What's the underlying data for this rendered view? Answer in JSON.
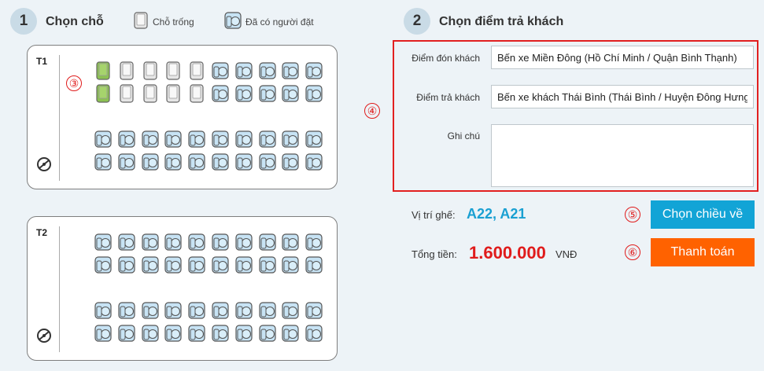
{
  "step1": {
    "number": "1",
    "title": "Chọn chỗ"
  },
  "legend": {
    "empty": "Chỗ trống",
    "booked": "Đã có người đặt"
  },
  "step2": {
    "number": "2",
    "title": "Chọn điểm trả khách"
  },
  "decks": [
    {
      "label": "T1",
      "rows": [
        [
          "selected",
          "empty",
          "empty",
          "empty",
          "empty",
          "booked",
          "booked",
          "booked",
          "booked",
          "booked"
        ],
        [
          "selected",
          "empty",
          "empty",
          "empty",
          "empty",
          "booked",
          "booked",
          "booked",
          "booked",
          "booked"
        ],
        [
          "booked",
          "booked",
          "booked",
          "booked",
          "booked",
          "booked",
          "booked",
          "booked",
          "booked",
          "booked"
        ],
        [
          "booked",
          "booked",
          "booked",
          "booked",
          "booked",
          "booked",
          "booked",
          "booked",
          "booked",
          "booked"
        ]
      ]
    },
    {
      "label": "T2",
      "rows": [
        [
          "booked",
          "booked",
          "booked",
          "booked",
          "booked",
          "booked",
          "booked",
          "booked",
          "booked",
          "booked"
        ],
        [
          "booked",
          "booked",
          "booked",
          "booked",
          "booked",
          "booked",
          "booked",
          "booked",
          "booked",
          "booked"
        ],
        [
          "booked",
          "booked",
          "booked",
          "booked",
          "booked",
          "booked",
          "booked",
          "booked",
          "booked",
          "booked"
        ],
        [
          "booked",
          "booked",
          "booked",
          "booked",
          "booked",
          "booked",
          "booked",
          "booked",
          "booked",
          "booked"
        ]
      ]
    }
  ],
  "form": {
    "pickup_label": "Điểm đón khách",
    "pickup_value": "Bến xe Miền Đông (Hồ Chí Minh / Quận Bình Thạnh)",
    "dropoff_label": "Điểm trả khách",
    "dropoff_value": "Bến xe khách Thái Bình (Thái Bình / Huyện Đông Hưng)",
    "note_label": "Ghi chú",
    "note_value": ""
  },
  "summary": {
    "seats_label": "Vị trí ghế:",
    "seats_value": "A22, A21",
    "total_label": "Tổng tiền:",
    "total_value": "1.600.000",
    "currency": "VNĐ"
  },
  "buttons": {
    "return_trip": "Chọn chiều về",
    "pay": "Thanh toán"
  },
  "callouts": [
    "③",
    "④",
    "⑤",
    "⑥"
  ],
  "colors": {
    "selected": "#8cc152",
    "empty": "#e6e6e6",
    "booked": "#c7e3f4",
    "accent": "#1aa0d2",
    "price": "#e01b1b",
    "pay": "#ff6200",
    "return": "#12a4d6"
  },
  "icons": {
    "empty_seat": "empty-seat-icon",
    "booked_seat": "booked-seat-icon",
    "steering": "steering-wheel-icon"
  }
}
